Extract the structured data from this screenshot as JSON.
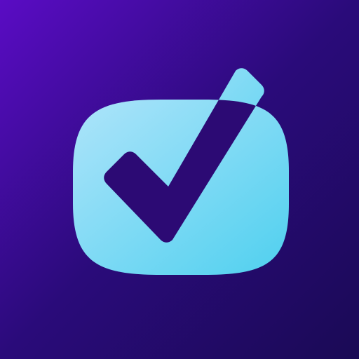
{
  "icon": {
    "name": "checkbox-check-icon",
    "colors": {
      "background_top_left": "#5a0cc4",
      "background_mid": "#2a0b7a",
      "background_bottom_right": "#1a0a55",
      "tile_light": "#aee4fa",
      "tile_dark": "#4fd0ef",
      "check_mark": "#2c0a74"
    }
  }
}
